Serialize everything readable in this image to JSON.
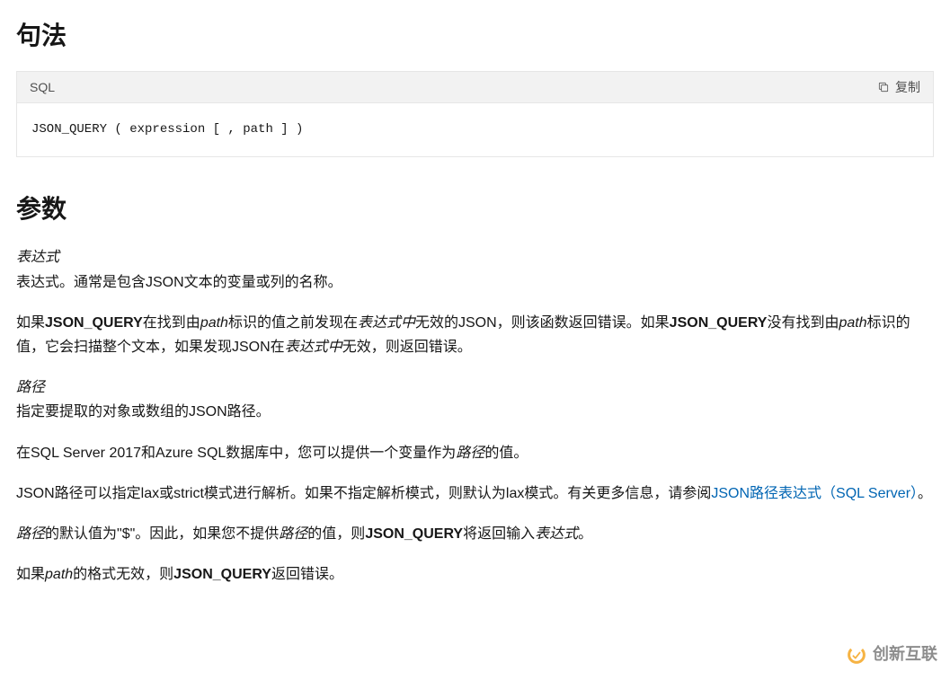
{
  "syntax": {
    "heading": "句法",
    "code_lang": "SQL",
    "copy_label": "复制",
    "code_text": "JSON_QUERY ( expression [ , path ] )  "
  },
  "params": {
    "heading": "参数",
    "expression_label": "表达式",
    "expression_desc": "表达式。通常是包含JSON文本的变量或列的名称。",
    "p1_t1": "如果",
    "p1_b1": "JSON_QUERY",
    "p1_t2": "在找到由",
    "p1_i1": "path",
    "p1_t3": "标识的值之前发现在",
    "p1_i2": "表达式中",
    "p1_t4": "无效的JSON，则该函数返回错误。如果",
    "p1_b2": "JSON_QUERY",
    "p1_t5": "没有找到由",
    "p1_i3": "path",
    "p1_t6": "标识的值，它会扫描整个文本，如果发现JSON在",
    "p1_i4": "表达式中",
    "p1_t7": "无效，则返回错误。",
    "path_label": "路径",
    "path_desc": "指定要提取的对象或数组的JSON路径。",
    "p2_t1": "在SQL Server 2017和Azure SQL数据库中，您可以提供一个变量作为",
    "p2_i1": "路径",
    "p2_t2": "的值。",
    "p3_t1": "JSON路径可以指定lax或strict模式进行解析。如果不指定解析模式，则默认为lax模式。有关更多信息，请参阅",
    "p3_link": "JSON路径表达式（SQL Server）",
    "p3_t2": "。",
    "p4_i1": "路径",
    "p4_t1": "的默认值为\"$\"。因此，如果您不提供",
    "p4_i2": "路径",
    "p4_t2": "的值，则",
    "p4_b1": "JSON_QUERY",
    "p4_t3": "将返回输入",
    "p4_i3": "表达式",
    "p4_t4": "。",
    "p5_t1": "如果",
    "p5_i1": "path",
    "p5_t2": "的格式无效，则",
    "p5_b1": "JSON_QUERY",
    "p5_t3": "返回错误。"
  },
  "watermark": {
    "text": "创新互联"
  }
}
